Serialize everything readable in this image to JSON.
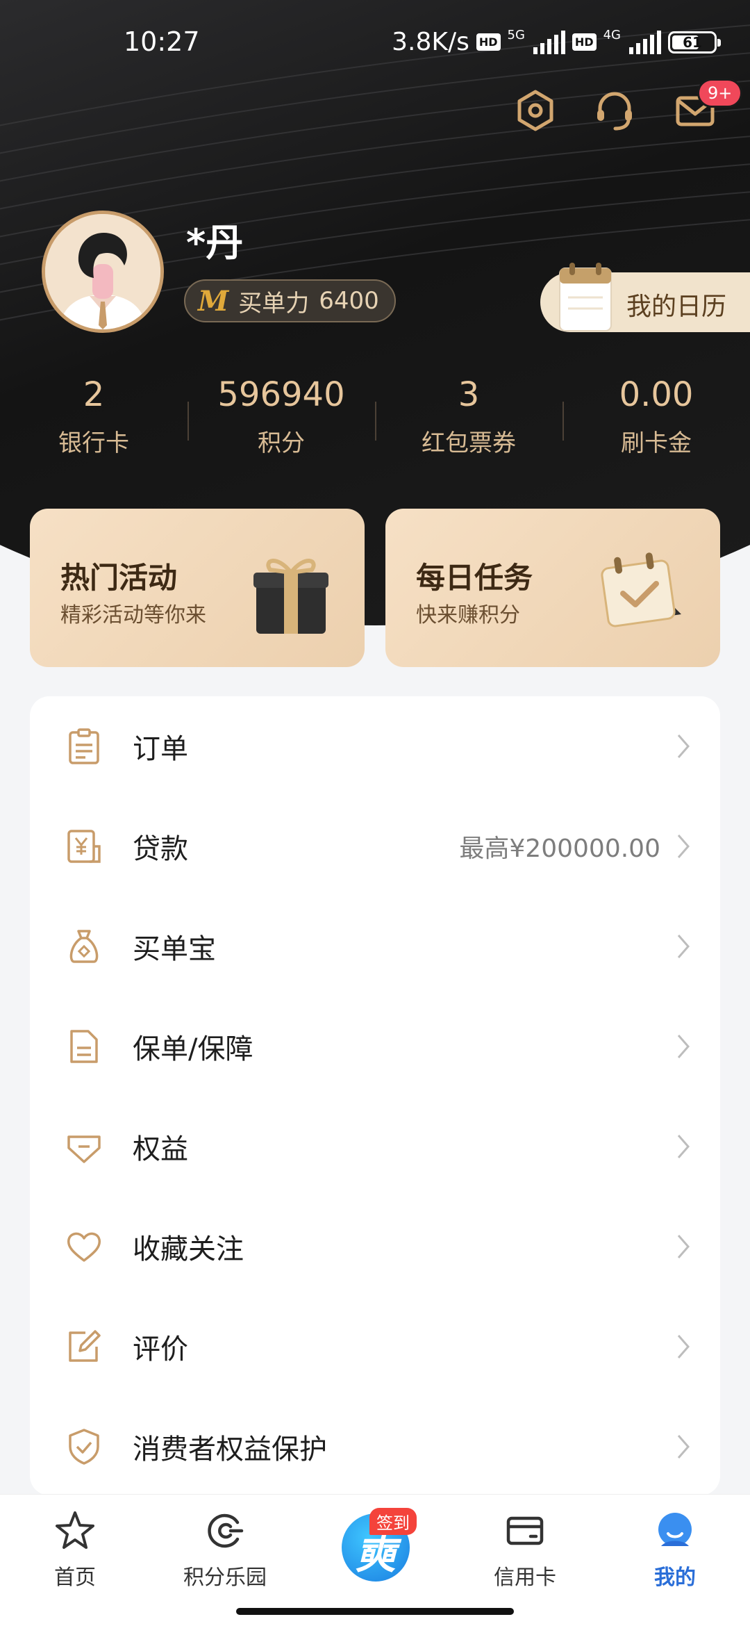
{
  "status_bar": {
    "time": "10:27",
    "speed": "3.8K/s",
    "net1": "5G",
    "net2": "4G",
    "hd": "HD",
    "battery": "61"
  },
  "header": {
    "notification_badge": "9+",
    "icons": [
      "settings-hexagon-icon",
      "customer-service-headset-icon",
      "mail-icon"
    ]
  },
  "profile": {
    "name": "*丹",
    "power_label": "买单力",
    "power_value": "6400",
    "calendar_label": "我的日历"
  },
  "stats": [
    {
      "value": "2",
      "label": "银行卡"
    },
    {
      "value": "596940",
      "label": "积分"
    },
    {
      "value": "3",
      "label": "红包票券"
    },
    {
      "value": "0.00",
      "label": "刷卡金"
    }
  ],
  "cards": [
    {
      "title": "热门活动",
      "subtitle": "精彩活动等你来"
    },
    {
      "title": "每日任务",
      "subtitle": "快来赚积分"
    }
  ],
  "menu": [
    {
      "label": "订单",
      "extra": "",
      "icon": "clipboard-icon"
    },
    {
      "label": "贷款",
      "extra": "最高¥200000.00",
      "icon": "loan-yen-icon"
    },
    {
      "label": "买单宝",
      "extra": "",
      "icon": "money-bag-icon"
    },
    {
      "label": "保单/保障",
      "extra": "",
      "icon": "document-icon"
    },
    {
      "label": "权益",
      "extra": "",
      "icon": "tag-icon"
    },
    {
      "label": "收藏关注",
      "extra": "",
      "icon": "heart-icon"
    },
    {
      "label": "评价",
      "extra": "",
      "icon": "edit-icon"
    },
    {
      "label": "消费者权益保护",
      "extra": "",
      "icon": "shield-check-icon"
    }
  ],
  "nav": {
    "home": "首页",
    "points_park": "积分乐园",
    "sign_badge": "签到",
    "sign_glyph": "奭",
    "credit_card": "信用卡",
    "mine": "我的",
    "active": "我的"
  },
  "colors": {
    "gold": "#c89c6a",
    "dark_bg": "#141414",
    "active_blue": "#2a6ed8"
  }
}
